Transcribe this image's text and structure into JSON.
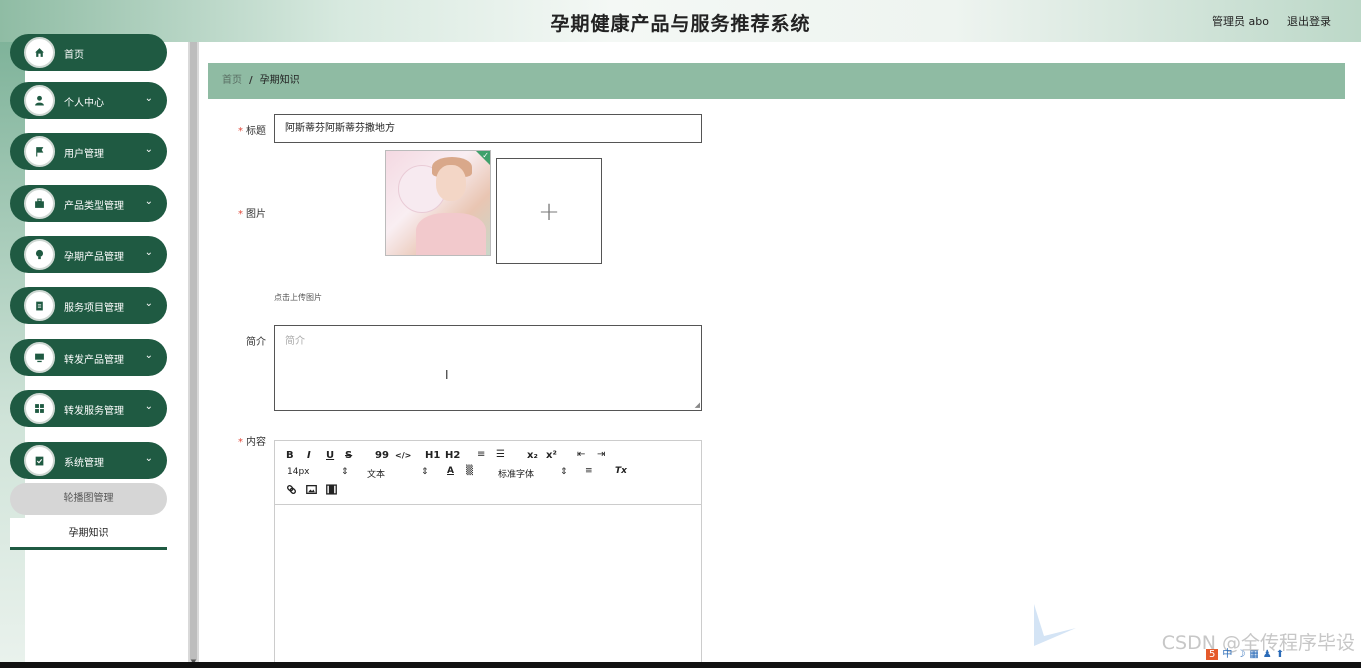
{
  "header": {
    "title": "孕期健康产品与服务推荐系统",
    "user": "管理员 abo",
    "logout": "退出登录"
  },
  "sidebar": {
    "items": [
      {
        "label": "首页",
        "icon": "home-icon",
        "has_chevron": false
      },
      {
        "label": "个人中心",
        "icon": "user-icon",
        "has_chevron": true
      },
      {
        "label": "用户管理",
        "icon": "flag-icon",
        "has_chevron": true
      },
      {
        "label": "产品类型管理",
        "icon": "briefcase-icon",
        "has_chevron": true
      },
      {
        "label": "孕期产品管理",
        "icon": "bulb-icon",
        "has_chevron": true
      },
      {
        "label": "服务项目管理",
        "icon": "clipboard-icon",
        "has_chevron": true
      },
      {
        "label": "转发产品管理",
        "icon": "monitor-icon",
        "has_chevron": true
      },
      {
        "label": "转发服务管理",
        "icon": "grid-icon",
        "has_chevron": true
      },
      {
        "label": "系统管理",
        "icon": "checklist-icon",
        "has_chevron": true
      }
    ],
    "subitems": [
      {
        "label": "轮播图管理",
        "active": true
      },
      {
        "label": "孕期知识",
        "active": false
      }
    ],
    "chevron": "⌄"
  },
  "breadcrumb": {
    "home": "首页",
    "separator": "/",
    "current": "孕期知识"
  },
  "form": {
    "title_label": "标题",
    "title_value": "阿斯蒂芬阿斯蒂芬撒地方",
    "image_label": "图片",
    "upload_hint": "点击上传图片",
    "intro_label": "简介",
    "intro_placeholder": "简介",
    "content_label": "内容",
    "required_mark": "*"
  },
  "editor": {
    "buttons_row1": [
      "B",
      "I",
      "U",
      "S",
      "99",
      "</>",
      "H1",
      "H2",
      "≡",
      "☰",
      "x₂",
      "x²",
      "⇤",
      "⇥"
    ],
    "font_size": "14px",
    "text_type": "文本",
    "font_family": "标准字体",
    "row2_icons": [
      "A",
      "▒",
      "≡",
      "Tx"
    ],
    "row3_icons": [
      "link-icon",
      "image-icon",
      "video-icon"
    ]
  },
  "watermark": "CSDN @全传程序毕设",
  "colors": {
    "accent": "#1f5a42",
    "breadcrumb_bg": "#8fbba3",
    "required": "#e04a3c"
  }
}
